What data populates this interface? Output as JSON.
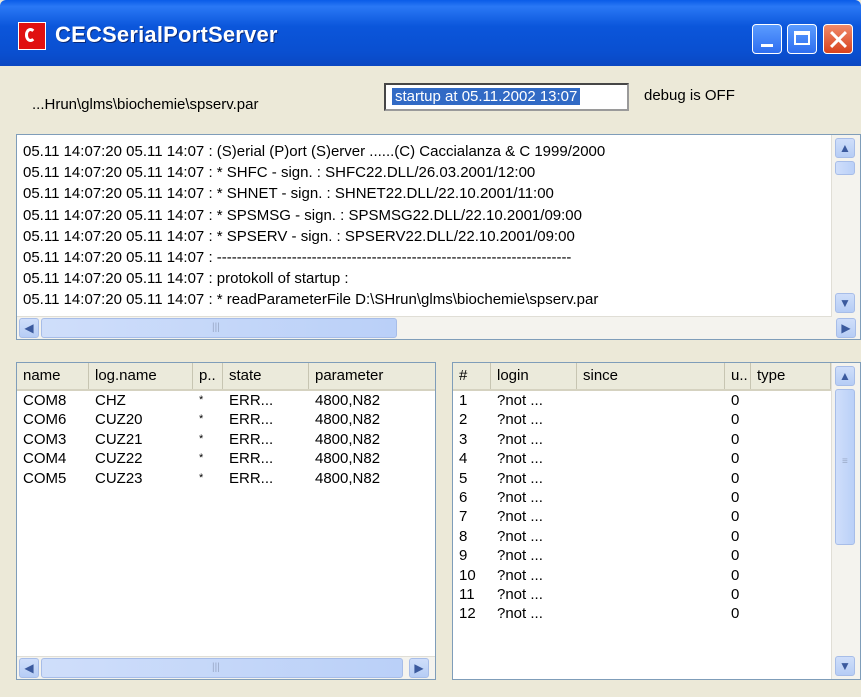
{
  "window": {
    "title": "CECSerialPortServer",
    "accent_color": "#0a4fd0",
    "close_color": "#d8421d"
  },
  "info": {
    "param_path": "...Hrun\\glms\\biochemie\\spserv.par",
    "startup": "startup at 05.11.2002 13:07",
    "debug": "debug is OFF"
  },
  "log": {
    "lines": [
      "05.11 14:07:20 05.11 14:07 : (S)erial (P)ort (S)erver ......(C) Caccialanza & C 1999/2000",
      "05.11 14:07:20 05.11 14:07 :  * SHFC -   sign. : SHFC22.DLL/26.03.2001/12:00",
      "05.11 14:07:20 05.11 14:07 :  * SHNET -  sign. : SHNET22.DLL/22.10.2001/11:00",
      "05.11 14:07:20 05.11 14:07 :  * SPSMSG - sign. : SPSMSG22.DLL/22.10.2001/09:00",
      "05.11 14:07:20 05.11 14:07 :  * SPSERV - sign. : SPSERV22.DLL/22.10.2001/09:00",
      "05.11 14:07:20 05.11 14:07 : -----------------------------------------------------------------------",
      "05.11 14:07:20 05.11 14:07 : protokoll of startup :",
      "05.11 14:07:20 05.11 14:07 : * readParameterFile D:\\SHrun\\glms\\biochemie\\spserv.par"
    ]
  },
  "ports": {
    "columns": [
      "name",
      "log.name",
      "p..",
      "state",
      "parameter"
    ],
    "rows": [
      [
        "COM8",
        "CHZ",
        "*",
        "ERR...",
        "4800,N82"
      ],
      [
        "COM6",
        "CUZ20",
        "*",
        "ERR...",
        "4800,N82"
      ],
      [
        "COM3",
        "CUZ21",
        "*",
        "ERR...",
        "4800,N82"
      ],
      [
        "COM4",
        "CUZ22",
        "*",
        "ERR...",
        "4800,N82"
      ],
      [
        "COM5",
        "CUZ23",
        "*",
        "ERR...",
        "4800,N82"
      ]
    ]
  },
  "sessions": {
    "columns": [
      "#",
      "login",
      "since",
      "u..",
      "type"
    ],
    "rows": [
      [
        "1",
        "?not ...",
        "",
        "0",
        ""
      ],
      [
        "2",
        "?not ...",
        "",
        "0",
        ""
      ],
      [
        "3",
        "?not ...",
        "",
        "0",
        ""
      ],
      [
        "4",
        "?not ...",
        "",
        "0",
        ""
      ],
      [
        "5",
        "?not ...",
        "",
        "0",
        ""
      ],
      [
        "6",
        "?not ...",
        "",
        "0",
        ""
      ],
      [
        "7",
        "?not ...",
        "",
        "0",
        ""
      ],
      [
        "8",
        "?not ...",
        "",
        "0",
        ""
      ],
      [
        "9",
        "?not ...",
        "",
        "0",
        ""
      ],
      [
        "10",
        "?not ...",
        "",
        "0",
        ""
      ],
      [
        "11",
        "?not ...",
        "",
        "0",
        ""
      ],
      [
        "12",
        "?not ...",
        "",
        "0",
        ""
      ]
    ]
  }
}
